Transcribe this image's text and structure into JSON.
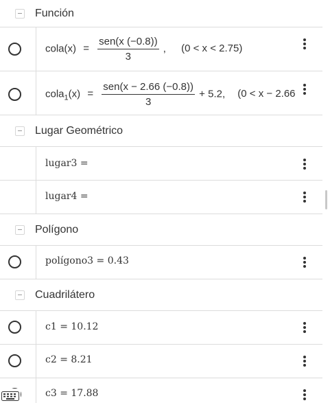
{
  "groups": {
    "funcion": "Función",
    "lugar": "Lugar Geométrico",
    "poligono": "Polígono",
    "cuadrilatero": "Cuadrilátero"
  },
  "rows": {
    "cola": {
      "lhs": "cola(x)",
      "eq": "=",
      "num": "sen(x (−0.8))",
      "den": "3",
      "tail": ",",
      "domain": "(0 < x < 2.75)"
    },
    "cola1": {
      "lhs_name": "cola",
      "lhs_sub": "1",
      "lhs_arg": "(x)",
      "eq": "=",
      "num": "sen(x − 2.66 (−0.8))",
      "den": "3",
      "tail": "+ 5.2,",
      "domain": "(0 < x − 2.66"
    },
    "lugar3": "lugar3 =",
    "lugar4": "lugar4 =",
    "poligono3": "polígono3 = 0.43",
    "c1": "c1 = 10.12",
    "c2": "c2 = 8.21",
    "c3": "c3 = 17.88"
  },
  "icons": {
    "kebab": "more-vertical-icon",
    "collapse": "collapse-minus-icon",
    "radio": "visibility-toggle-icon",
    "keyboard": "keyboard-icon"
  }
}
